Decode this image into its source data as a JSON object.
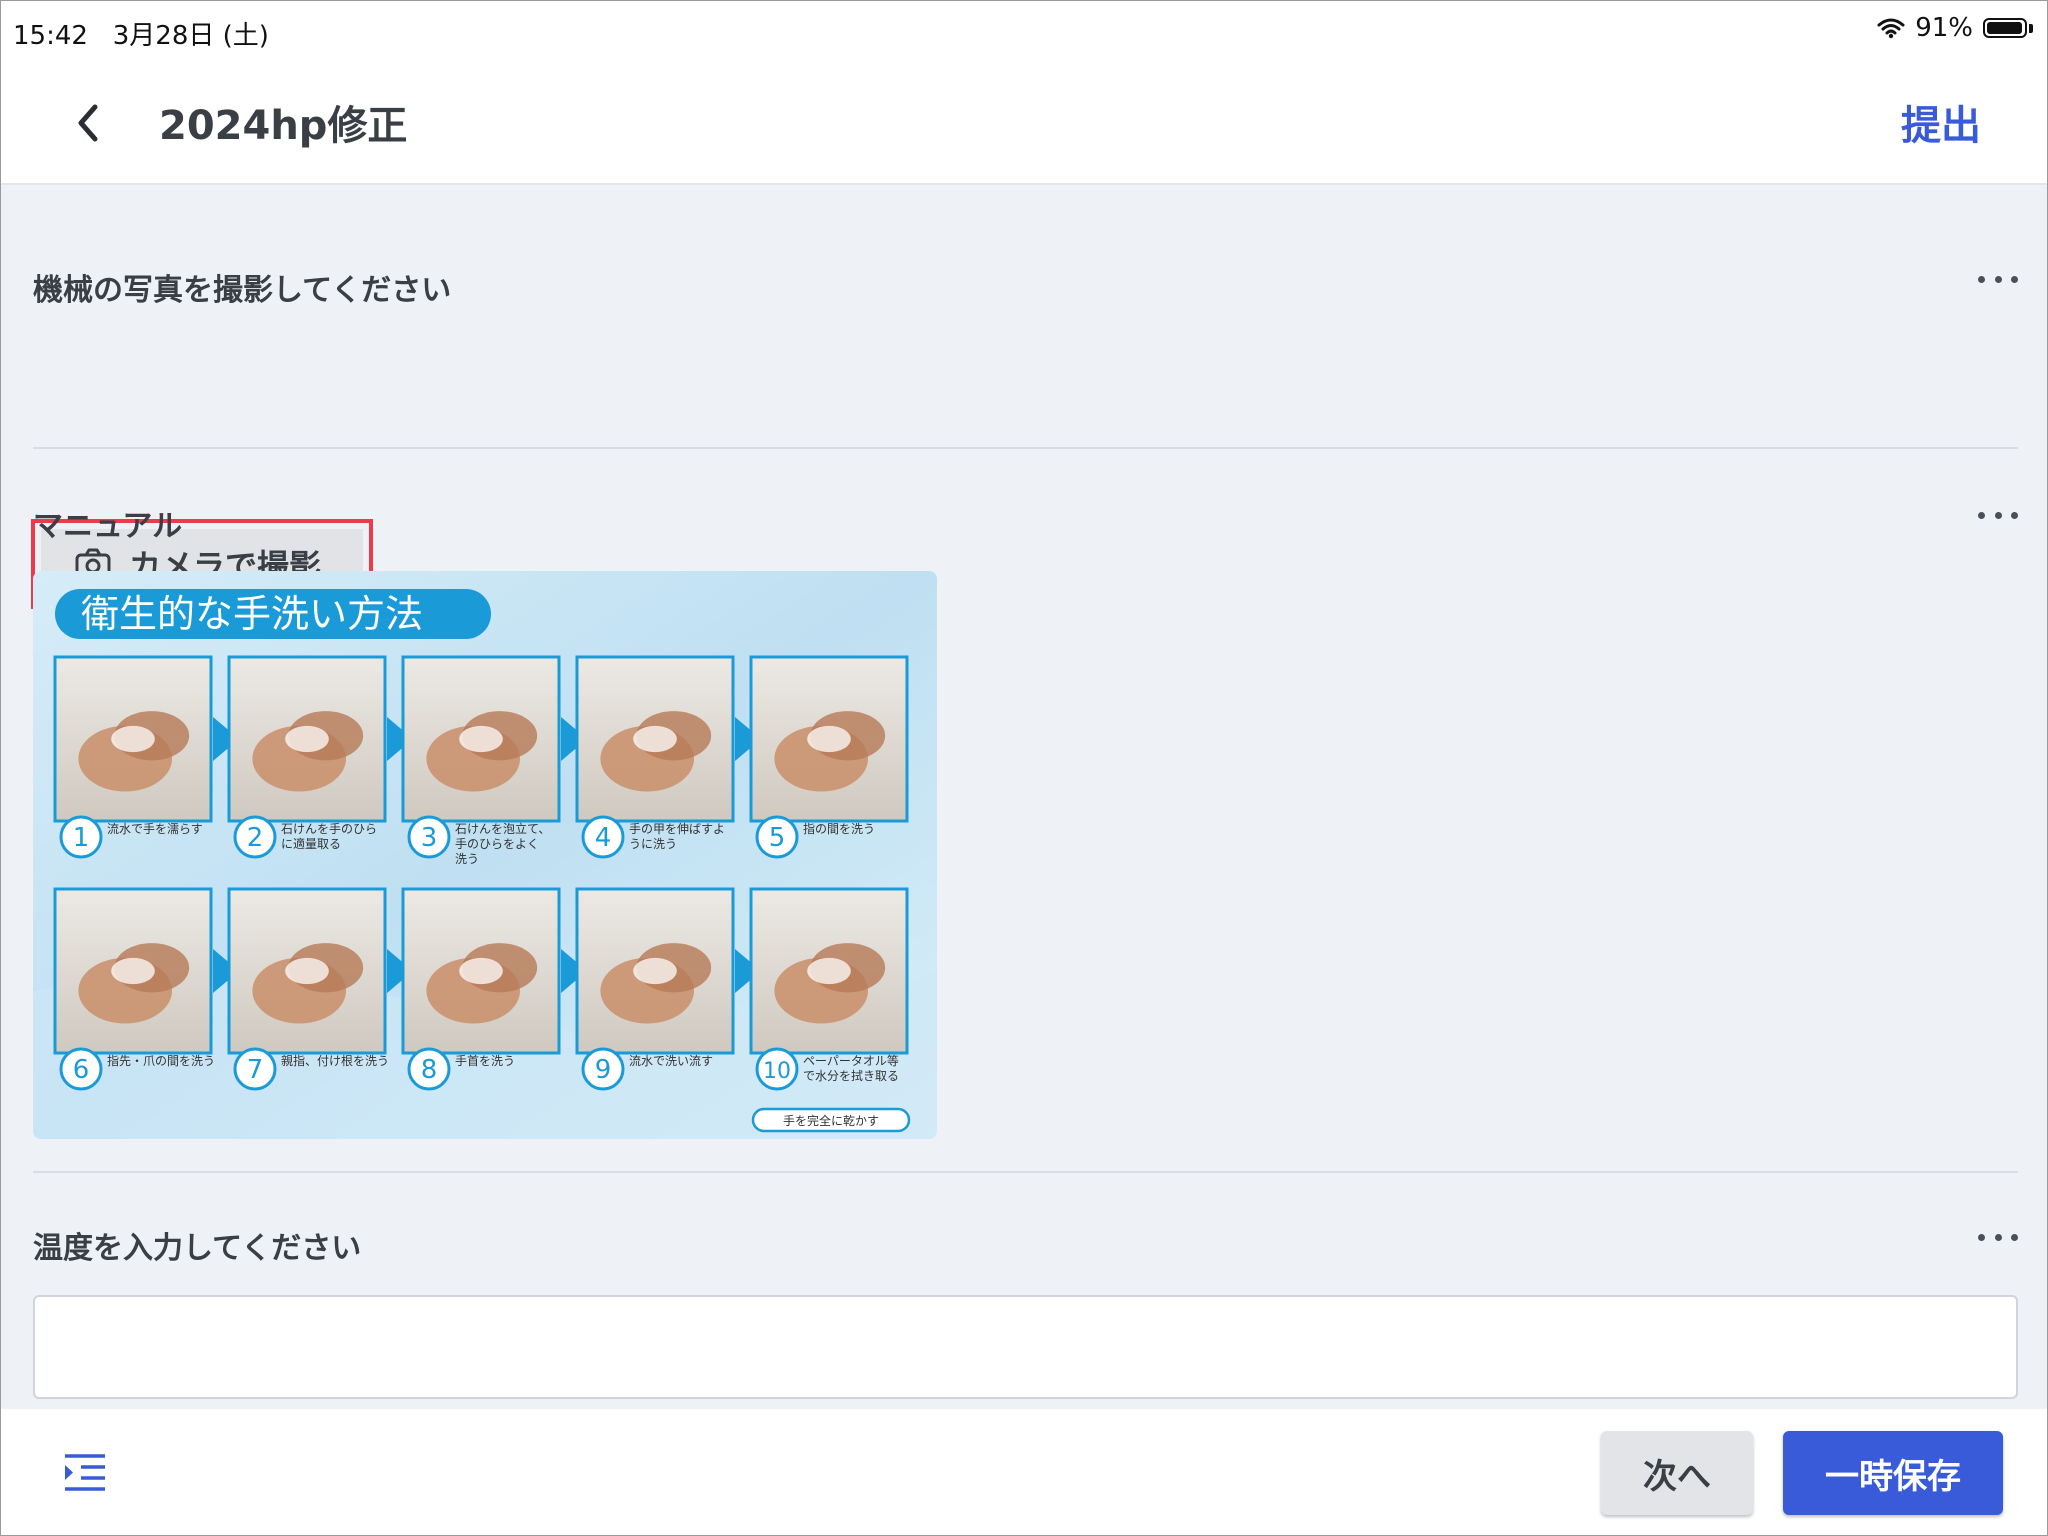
{
  "status_bar": {
    "time": "15:42",
    "date": "3月28日 (土)",
    "battery": "91%"
  },
  "header": {
    "title": "2024hp修正",
    "submit_label": "提出"
  },
  "sections": {
    "photo": {
      "title": "機械の写真を撮影してください",
      "camera_label": "カメラで撮影"
    },
    "manual": {
      "title": "マニュアル",
      "image": {
        "heading": "衛生的な手洗い方法",
        "steps": [
          {
            "num": "1",
            "text": [
              "流水で手を濡らす"
            ]
          },
          {
            "num": "2",
            "text": [
              "石けんを手のひら",
              "に適量取る"
            ]
          },
          {
            "num": "3",
            "text": [
              "石けんを泡立て、",
              "手のひらをよく",
              "洗う"
            ]
          },
          {
            "num": "4",
            "text": [
              "手の甲を伸ばすよ",
              "うに洗う"
            ]
          },
          {
            "num": "5",
            "text": [
              "指の間を洗う"
            ]
          },
          {
            "num": "6",
            "text": [
              "指先・爪の間を洗う"
            ]
          },
          {
            "num": "7",
            "text": [
              "親指、付け根を洗う"
            ]
          },
          {
            "num": "8",
            "text": [
              "手首を洗う"
            ]
          },
          {
            "num": "9",
            "text": [
              "流水で洗い流す"
            ]
          },
          {
            "num": "10",
            "text": [
              "ペーパータオル等",
              "で水分を拭き取る"
            ]
          }
        ],
        "final_badge": "手を完全に乾かす"
      }
    },
    "temperature": {
      "title": "温度を入力してください",
      "value": "",
      "placeholder": ""
    }
  },
  "footer": {
    "next_label": "次へ",
    "save_label": "一時保存"
  },
  "colors": {
    "accent": "#3a5bd9",
    "highlight": "#ee3b4c",
    "background": "#eef1f6",
    "manual_blue": "#1a9ad6"
  }
}
